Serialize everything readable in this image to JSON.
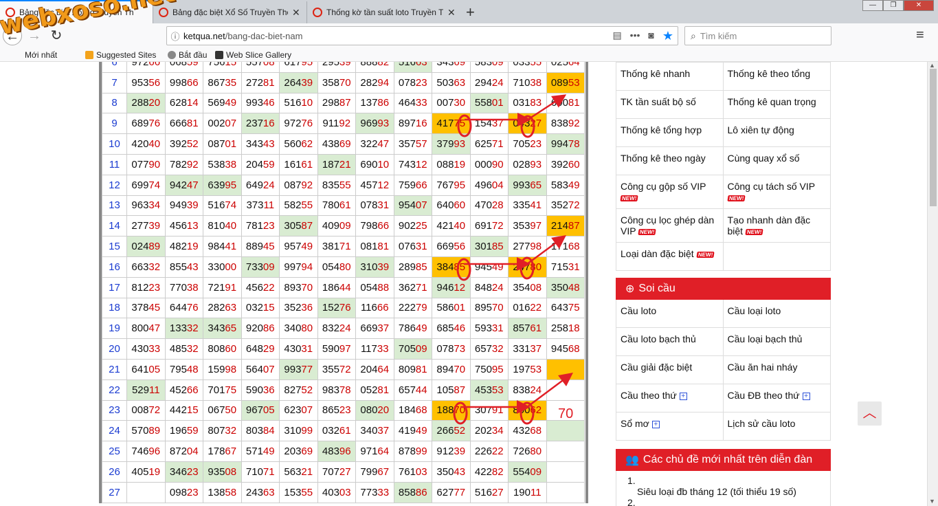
{
  "browser": {
    "tabs": [
      {
        "title": "Bảng đặc biệt Xổ Số Truyền Th",
        "active": true
      },
      {
        "title": "Bảng đặc biệt Xổ Số Truyền Thố",
        "active": false
      },
      {
        "title": "Thống kờ tần suất loto Truyền T",
        "active": false
      }
    ],
    "new_tab": "+",
    "url_host": "ketqua.net",
    "url_path": "/bang-dac-biet-nam",
    "search_placeholder": "Tìm kiếm",
    "bookmarks": [
      "Mới nhất",
      "Suggested Sites",
      "Bắt đầu",
      "Web Slice Gallery"
    ]
  },
  "watermark": "webxoso.net",
  "table": {
    "rows": [
      {
        "idx": "6",
        "cells": [
          "97266",
          "06859",
          "75615",
          "55708",
          "61795",
          "29539",
          "88882",
          "51663",
          "34369",
          "58309",
          "03355",
          "02564"
        ],
        "hl": {
          "7": "g"
        }
      },
      {
        "idx": "7",
        "cells": [
          "95356",
          "99866",
          "86735",
          "27281",
          "26439",
          "35870",
          "28294",
          "07823",
          "50363",
          "29424",
          "71038",
          "08953"
        ],
        "hl": {
          "4": "g",
          "11": "o"
        }
      },
      {
        "idx": "8",
        "cells": [
          "28820",
          "62814",
          "56949",
          "99346",
          "51610",
          "29887",
          "13786",
          "46433",
          "00730",
          "55801",
          "03183",
          "60081"
        ],
        "hl": {
          "0": "g",
          "9": "g"
        }
      },
      {
        "idx": "9",
        "cells": [
          "68976",
          "66681",
          "00207",
          "23716",
          "97276",
          "91192",
          "96993",
          "89716",
          "41775",
          "15437",
          "04327",
          "83892"
        ],
        "hl": {
          "3": "g",
          "6": "g",
          "8": "o",
          "10": "o"
        }
      },
      {
        "idx": "10",
        "cells": [
          "42040",
          "39252",
          "08701",
          "34343",
          "56062",
          "43869",
          "32247",
          "35757",
          "37993",
          "62571",
          "70523",
          "99478"
        ],
        "hl": {
          "8": "g",
          "11": "g"
        }
      },
      {
        "idx": "11",
        "cells": [
          "07790",
          "78292",
          "53838",
          "20459",
          "16161",
          "18721",
          "69010",
          "74312",
          "08819",
          "00090",
          "02893",
          "39260"
        ],
        "hl": {
          "5": "g"
        }
      },
      {
        "idx": "12",
        "cells": [
          "69974",
          "94247",
          "63995",
          "64924",
          "08792",
          "83555",
          "45712",
          "75966",
          "76795",
          "49604",
          "99365",
          "58349"
        ],
        "hl": {
          "1": "g",
          "2": "g",
          "10": "g"
        }
      },
      {
        "idx": "13",
        "cells": [
          "96334",
          "94939",
          "51674",
          "37311",
          "58255",
          "78061",
          "07831",
          "95407",
          "64060",
          "47028",
          "33541",
          "35272"
        ],
        "hl": {
          "7": "g"
        }
      },
      {
        "idx": "14",
        "cells": [
          "27739",
          "45613",
          "81040",
          "78123",
          "30587",
          "40909",
          "79866",
          "90225",
          "42140",
          "69172",
          "35397",
          "21487"
        ],
        "hl": {
          "4": "g",
          "11": "o"
        }
      },
      {
        "idx": "15",
        "cells": [
          "02489",
          "48219",
          "98441",
          "88945",
          "95749",
          "38171",
          "08181",
          "07631",
          "66956",
          "30185",
          "27798",
          "17168"
        ],
        "hl": {
          "0": "g",
          "9": "g"
        }
      },
      {
        "idx": "16",
        "cells": [
          "66332",
          "85543",
          "33000",
          "73309",
          "99794",
          "05480",
          "31039",
          "28985",
          "38485",
          "94549",
          "24780",
          "71531"
        ],
        "hl": {
          "3": "g",
          "6": "g",
          "8": "o",
          "10": "o"
        }
      },
      {
        "idx": "17",
        "cells": [
          "81223",
          "77038",
          "72191",
          "45622",
          "89370",
          "18644",
          "05488",
          "36271",
          "94612",
          "84824",
          "35408",
          "35048"
        ],
        "hl": {
          "8": "g",
          "11": "g"
        }
      },
      {
        "idx": "18",
        "cells": [
          "37845",
          "64476",
          "28263",
          "03215",
          "35236",
          "15276",
          "11666",
          "22279",
          "58601",
          "89570",
          "01622",
          "64375"
        ],
        "hl": {
          "5": "g"
        }
      },
      {
        "idx": "19",
        "cells": [
          "80047",
          "13332",
          "34365",
          "92086",
          "34080",
          "83224",
          "66937",
          "78649",
          "68546",
          "59331",
          "85761",
          "25818"
        ],
        "hl": {
          "1": "g",
          "2": "g",
          "10": "g"
        }
      },
      {
        "idx": "20",
        "cells": [
          "43033",
          "48532",
          "80860",
          "64829",
          "43031",
          "59097",
          "11733",
          "70509",
          "07873",
          "65732",
          "33137",
          "94568"
        ],
        "hl": {
          "7": "g"
        }
      },
      {
        "idx": "21",
        "cells": [
          "64105",
          "79548",
          "15998",
          "56407",
          "99377",
          "35572",
          "20464",
          "80981",
          "89470",
          "75095",
          "19753",
          ""
        ],
        "hl": {
          "4": "g",
          "11": "o"
        }
      },
      {
        "idx": "22",
        "cells": [
          "52911",
          "45266",
          "70175",
          "59036",
          "82752",
          "98378",
          "05281",
          "65744",
          "10587",
          "45353",
          "83824",
          ""
        ],
        "hl": {
          "0": "g",
          "9": "g"
        }
      },
      {
        "idx": "23",
        "cells": [
          "00872",
          "44215",
          "06750",
          "96705",
          "62307",
          "86523",
          "08020",
          "18468",
          "18870",
          "30791",
          "80062",
          ""
        ],
        "hl": {
          "3": "g",
          "6": "g",
          "8": "o",
          "10": "o"
        }
      },
      {
        "idx": "24",
        "cells": [
          "57089",
          "19659",
          "80732",
          "80384",
          "31099",
          "03261",
          "34037",
          "41949",
          "26652",
          "20234",
          "43268",
          ""
        ],
        "hl": {
          "8": "g",
          "11": "g"
        }
      },
      {
        "idx": "25",
        "cells": [
          "74696",
          "87204",
          "17867",
          "57149",
          "20369",
          "48396",
          "97164",
          "87899",
          "91239",
          "22622",
          "72680",
          ""
        ],
        "hl": {
          "5": "g"
        }
      },
      {
        "idx": "26",
        "cells": [
          "40519",
          "34623",
          "93508",
          "71071",
          "56321",
          "70727",
          "79967",
          "76103",
          "35043",
          "42282",
          "55409",
          ""
        ],
        "hl": {
          "1": "g",
          "2": "g",
          "10": "g"
        }
      },
      {
        "idx": "27",
        "cells": [
          "",
          "09823",
          "13858",
          "24363",
          "15355",
          "40303",
          "77333",
          "85886",
          "62777",
          "51627",
          "19011",
          ""
        ],
        "hl": {
          "7": "g"
        }
      }
    ],
    "prediction": "70"
  },
  "sidebar": {
    "thongke": [
      [
        "Thống kê nhanh",
        "Thống kê theo tổng"
      ],
      [
        "TK tần suất bộ số",
        "Thống kê quan trọng"
      ],
      [
        "Thống kê tổng hợp",
        "Lô xiên tự động"
      ],
      [
        "Thống kê theo ngày",
        "Cùng quay xổ số"
      ],
      [
        "Công cụ gộp số VIP",
        "Công cụ tách số VIP"
      ],
      [
        "Công cụ lọc ghép dàn VIP",
        "Tạo nhanh dàn đặc biệt"
      ],
      [
        "Loại dàn đặc biệt",
        ""
      ]
    ],
    "new_badge": "NEW!",
    "soicau_title": "Soi cầu",
    "soicau": [
      [
        "Cầu loto",
        "Cầu loại loto"
      ],
      [
        "Cầu loto bạch thủ",
        "Cầu loại bạch thủ"
      ],
      [
        "Cầu giải đặc biệt",
        "Cầu ăn hai nháy"
      ],
      [
        "Cầu theo thứ",
        "Cầu ĐB theo thứ"
      ],
      [
        "Sổ mơ",
        "Lịch sử cầu loto"
      ]
    ],
    "forum_title": "Các chủ đề mới nhất trên diễn đàn",
    "forum_items": [
      "1.",
      "Siêu loại đb tháng 12 (tối thiểu 19 số)",
      "2."
    ]
  }
}
